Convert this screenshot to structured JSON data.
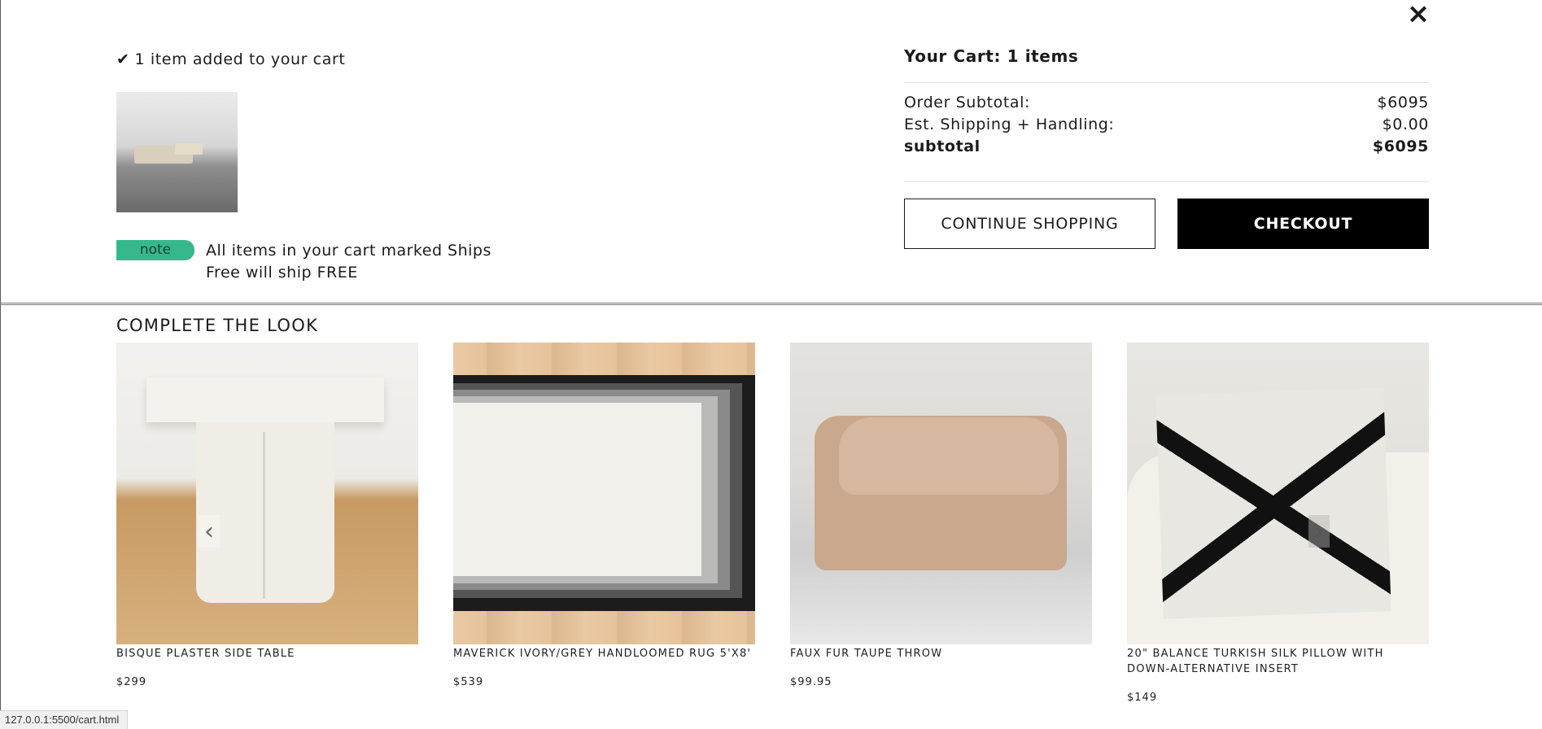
{
  "modal": {
    "close_icon": "×",
    "added_check": "✔",
    "added_text": "1 item added to your cart",
    "note_label": "note",
    "note_text": "All items in your cart marked Ships Free will ship FREE"
  },
  "cart": {
    "title": "Your Cart: 1 items",
    "rows": [
      {
        "label": "Order Subtotal:",
        "value": "$6095"
      },
      {
        "label": "Est. Shipping + Handling:",
        "value": "$0.00"
      },
      {
        "label": "subtotal",
        "value": "$6095"
      }
    ],
    "continue_label": "CONTINUE SHOPPING",
    "checkout_label": "CHECKOUT"
  },
  "look": {
    "title": "COMPLETE THE LOOK",
    "prev_icon": "‹",
    "next_icon": "›",
    "items": [
      {
        "name": "BISQUE PLASTER SIDE TABLE",
        "price": "$299"
      },
      {
        "name": "MAVERICK IVORY/GREY HANDLOOMED RUG 5'X8'",
        "price": "$539"
      },
      {
        "name": "FAUX FUR TAUPE THROW",
        "price": "$99.95"
      },
      {
        "name": "20\" BALANCE TURKISH SILK PILLOW WITH DOWN-ALTERNATIVE INSERT",
        "price": "$149"
      }
    ]
  },
  "status_bar": {
    "url": "127.0.0.1:5500/cart.html"
  }
}
